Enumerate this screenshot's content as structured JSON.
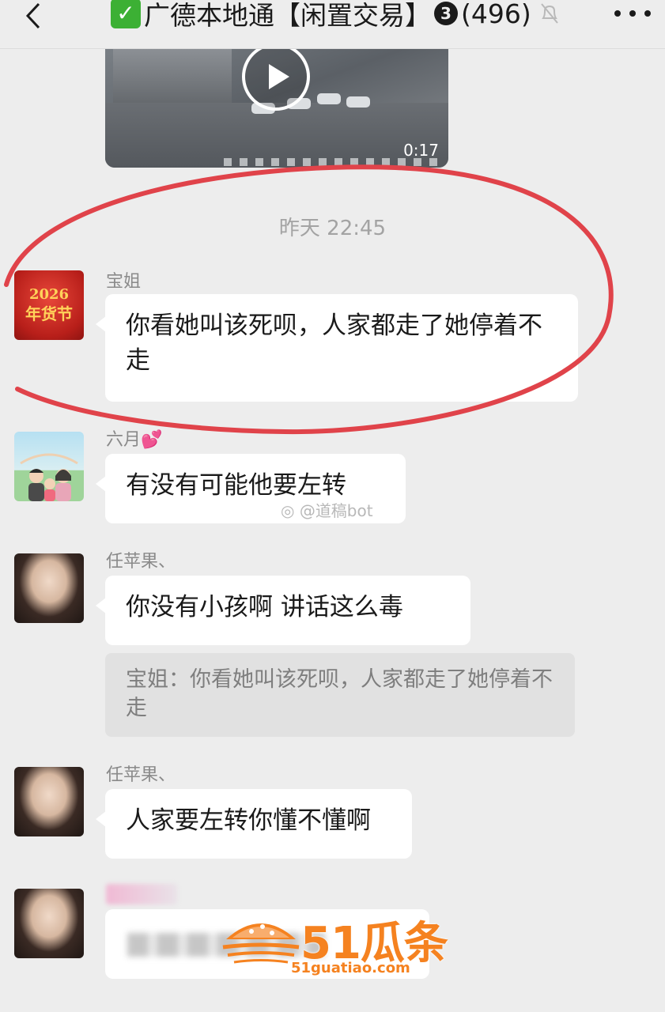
{
  "header": {
    "title_prefix": "广德本地通【闲置交易】",
    "title_badge": "3",
    "member_count": "(496)"
  },
  "video": {
    "duration": "0:17"
  },
  "timestamp": "昨天 22:45",
  "messages": [
    {
      "sender": "宝姐",
      "text": "你看她叫该死呗，人家都走了她停着不走",
      "avatar_text": [
        "2026",
        "年货节"
      ]
    },
    {
      "sender": "六月💕",
      "text": "有没有可能他要左转"
    },
    {
      "sender": "任苹果、",
      "text": "你没有小孩啊 讲话这么毒",
      "quote": "宝姐：你看她叫该死呗，人家都走了她停着不走"
    },
    {
      "sender": "任苹果、",
      "text": "人家要左转你懂不懂啊"
    }
  ],
  "watermark": {
    "weibo": "@道稿bot",
    "logo_text": "51瓜条",
    "logo_url": "51guatiao.com"
  },
  "colors": {
    "background": "#ededed",
    "bubble": "#ffffff",
    "annotation": "#e0434a",
    "logo": "#f58220",
    "verified_check": "#3cb034"
  }
}
